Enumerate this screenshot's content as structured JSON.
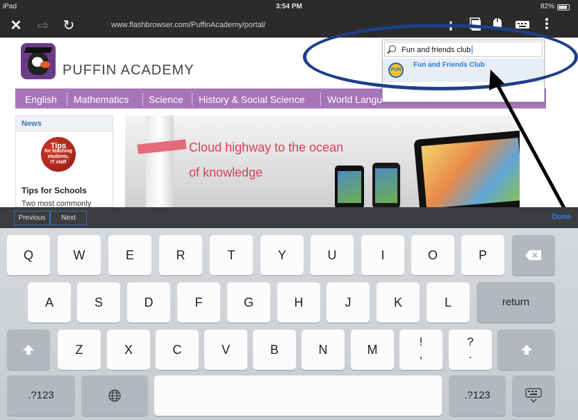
{
  "status": {
    "device": "iPad",
    "time": "3:54 PM",
    "battery": "82%"
  },
  "toolbar": {
    "url": "www.flashbrowser.com/PuffinAcademy/portal/",
    "icons": [
      "close-icon",
      "forward-icon",
      "reload-icon",
      "add-icon",
      "tabs-icon",
      "mouse-icon",
      "keyboard-icon",
      "more-icon"
    ]
  },
  "page": {
    "brand": "PUFFIN ACADEMY",
    "menu": [
      "English",
      "Mathematics",
      "Science",
      "History & Social Science",
      "World Langu"
    ],
    "news": {
      "heading": "News",
      "seal_line1": "Tips",
      "seal_line2": "for teaching",
      "seal_line3": "students,",
      "seal_line4": "IT staff",
      "title": "Tips for Schools",
      "snippet": "Two most commonly"
    },
    "banner": {
      "line1": "Cloud highway to the ocean",
      "line2": "of knowledge"
    }
  },
  "search": {
    "query": "Fun and friends club",
    "suggestion": "Fun and Friends Club",
    "suggestion_logo": "FUN"
  },
  "accessory": {
    "previous": "Previous",
    "next": "Next",
    "done": "Done"
  },
  "keyboard": {
    "row1": [
      "Q",
      "W",
      "E",
      "R",
      "T",
      "Y",
      "U",
      "I",
      "O",
      "P"
    ],
    "row2": [
      "A",
      "S",
      "D",
      "F",
      "G",
      "H",
      "J",
      "K",
      "L"
    ],
    "row3": [
      "Z",
      "X",
      "C",
      "V",
      "B",
      "N",
      "M"
    ],
    "punct1_top": "!",
    "punct1_bottom": ",",
    "punct2_top": "?",
    "punct2_bottom": ".",
    "return_label": "return",
    "numbers_label": ".?123",
    "icons": [
      "delete-icon",
      "shift-icon",
      "globe-icon",
      "hide-keyboard-icon"
    ]
  },
  "colors": {
    "menu_bar": "#a874b8",
    "annotation": "#1d3f8a",
    "link_blue": "#2a7fd4",
    "banner_text": "#d6405a"
  }
}
